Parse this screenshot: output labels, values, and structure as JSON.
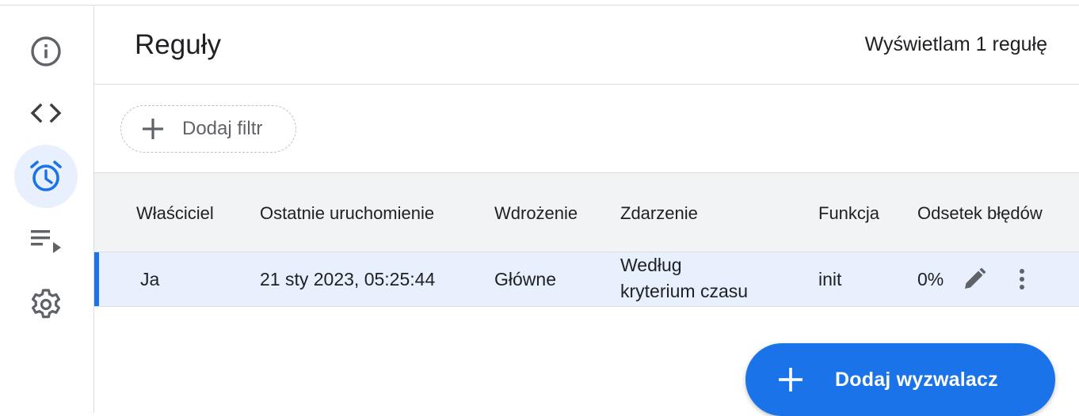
{
  "sidebar": {
    "items": [
      {
        "icon": "info-icon"
      },
      {
        "icon": "code-icon"
      },
      {
        "icon": "alarm-clock-icon",
        "active": true
      },
      {
        "icon": "playlist-play-icon"
      },
      {
        "icon": "gear-icon"
      }
    ]
  },
  "header": {
    "title": "Reguły",
    "count_text": "Wyświetlam 1 regułę"
  },
  "filter": {
    "add_label": "Dodaj filtr"
  },
  "table": {
    "columns": [
      "Właściciel",
      "Ostatnie uruchomienie",
      "Wdrożenie",
      "Zdarzenie",
      "Funkcja",
      "Odsetek błędów"
    ],
    "rows": [
      {
        "owner": "Ja",
        "last_run": "21 sty 2023, 05:25:44",
        "deployment": "Główne",
        "event_line1": "Według",
        "event_line2": "kryterium czasu",
        "function": "init",
        "error_rate": "0%"
      }
    ]
  },
  "fab": {
    "label": "Dodaj wyzwalacz"
  },
  "colors": {
    "accent": "#1a73e8",
    "selected_row": "#e8f0fe",
    "header_bg": "#f1f3f4"
  }
}
